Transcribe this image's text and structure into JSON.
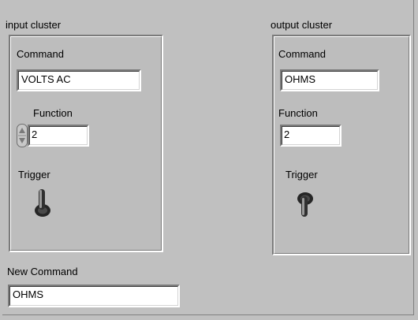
{
  "input_cluster": {
    "title": "input cluster",
    "command_label": "Command",
    "command_value": "VOLTS AC",
    "function_label": "Function",
    "function_value": "2",
    "trigger_label": "Trigger"
  },
  "output_cluster": {
    "title": "output cluster",
    "command_label": "Command",
    "command_value": "OHMS",
    "function_label": "Function",
    "function_value": "2",
    "trigger_label": "Trigger"
  },
  "new_command": {
    "label": "New Command",
    "value": "OHMS"
  },
  "colors": {
    "panel": "#c0c0c0",
    "field": "#ffffff"
  }
}
